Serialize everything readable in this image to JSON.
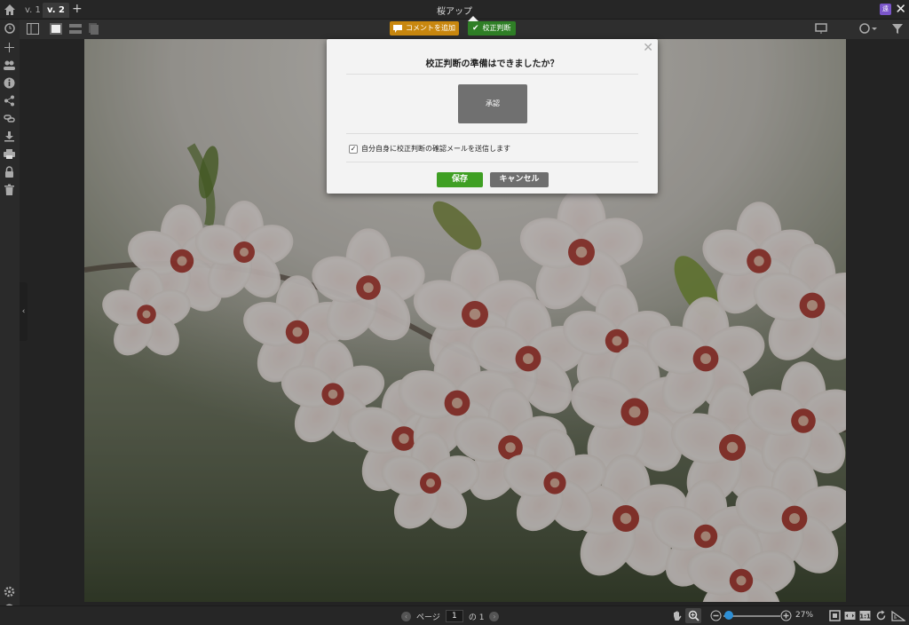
{
  "window": {
    "title": "桜アップ"
  },
  "tabs": [
    {
      "label": "v. 1"
    },
    {
      "label": "v. 2"
    }
  ],
  "tab_add_label": "+",
  "window_badge_label": "遠",
  "window_close_label": "✕",
  "toolbar": {
    "comment_label": "コメントを追加",
    "proof_label": "校正判断",
    "accent_comment": "#c8870f",
    "accent_proof": "#2f7f26"
  },
  "sidebar": {
    "icons": [
      "home-icon",
      "history-icon",
      "add-icon",
      "users-icon",
      "info-icon",
      "share-icon",
      "link-icon",
      "download-icon",
      "print-icon",
      "lock-icon",
      "trash-icon",
      "settings-icon",
      "help-icon"
    ],
    "collapse_label": "‹"
  },
  "modal": {
    "title": "校正判断の準備はできましたか？",
    "close_label": "✕",
    "approve_label": "承認",
    "checkbox_label": "自分自身に校正判断の確認メールを送信します",
    "checkbox_checked": true,
    "checkbox_mark": "✓",
    "save_label": "保存",
    "cancel_label": "キャンセル"
  },
  "pager": {
    "prev": "‹",
    "next": "›",
    "page_label": "ページ",
    "current_page": "1",
    "of_label": "の 1"
  },
  "zoom": {
    "value": "27%",
    "level": 0.05,
    "accent": "#2d8fd6"
  }
}
